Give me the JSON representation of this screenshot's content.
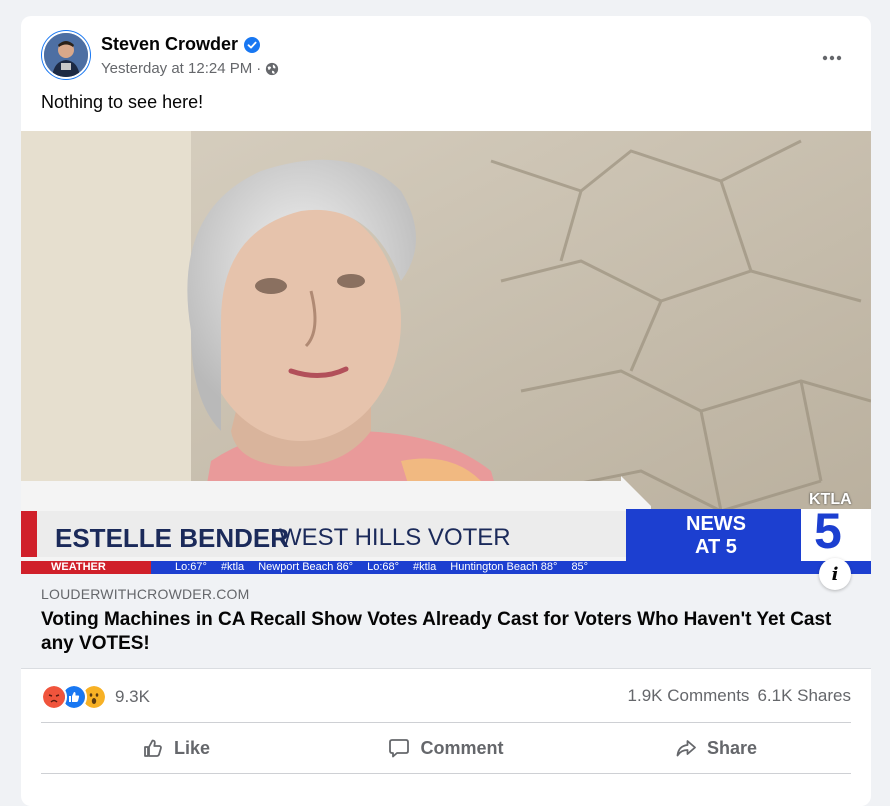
{
  "post": {
    "author": "Steven Crowder",
    "timestamp": "Yesterday at 12:24 PM",
    "separator": "·",
    "text": "Nothing to see here!"
  },
  "link": {
    "domain": "LOUDERWITHCROWDER.COM",
    "headline": "Voting Machines in CA Recall Show Votes Already Cast for Voters Who Haven't Yet Cast any VOTES!",
    "info_label": "i"
  },
  "broadcast": {
    "lower_third_name": "ESTELLE BENDER",
    "lower_third_title": "WEST HILLS VOTER",
    "news_line1": "NEWS",
    "news_line2": "AT 5",
    "station": "KTLA",
    "channel": "5",
    "ticker_label": "WEATHER",
    "ticker_items": [
      "Lo:67°",
      "#ktla",
      "Newport Beach 86°",
      "Lo:68°",
      "#ktla",
      "Huntington Beach 88°",
      "85°"
    ]
  },
  "stats": {
    "reaction_count": "9.3K",
    "comments": "1.9K Comments",
    "shares": "6.1K Shares"
  },
  "actions": {
    "like": "Like",
    "comment": "Comment",
    "share": "Share"
  },
  "colors": {
    "brand_blue": "#1877f2",
    "secondary_text": "#65676b",
    "angry": "#f0543c",
    "wow": "#f7b125"
  }
}
